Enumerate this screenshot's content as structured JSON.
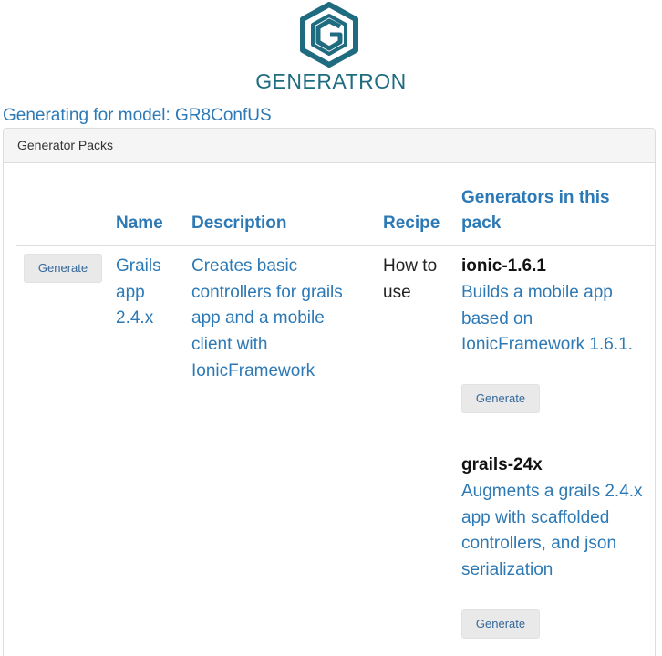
{
  "brand": {
    "name": "GENERATRON",
    "logo_icon": "hexagon-g-logo-icon",
    "color": "#1f6c80"
  },
  "model": {
    "text": "Generating for model: GR8ConfUS"
  },
  "panel": {
    "title": "Generator Packs"
  },
  "table": {
    "headers": {
      "name": "Name",
      "description": "Description",
      "recipe": "Recipe",
      "generators": "Generators in this pack"
    },
    "rows": [
      {
        "generate_label": "Generate",
        "name": "Grails app 2.4.x",
        "description": "Creates basic controllers for grails app and a mobile client with IonicFramework",
        "recipe": "How to use",
        "generators": [
          {
            "name": "ionic-1.6.1",
            "description": "Builds a mobile app based on IonicFramework 1.6.1.",
            "generate_label": "Generate"
          },
          {
            "name": "grails-24x",
            "description": "Augments a grails 2.4.x app with scaffolded controllers, and json serialization",
            "generate_label": "Generate"
          }
        ]
      }
    ]
  },
  "colors": {
    "link": "#2d79b5",
    "button_bg": "#e9e9e9",
    "panel_heading_bg": "#f5f5f5",
    "border": "#dddddd"
  }
}
